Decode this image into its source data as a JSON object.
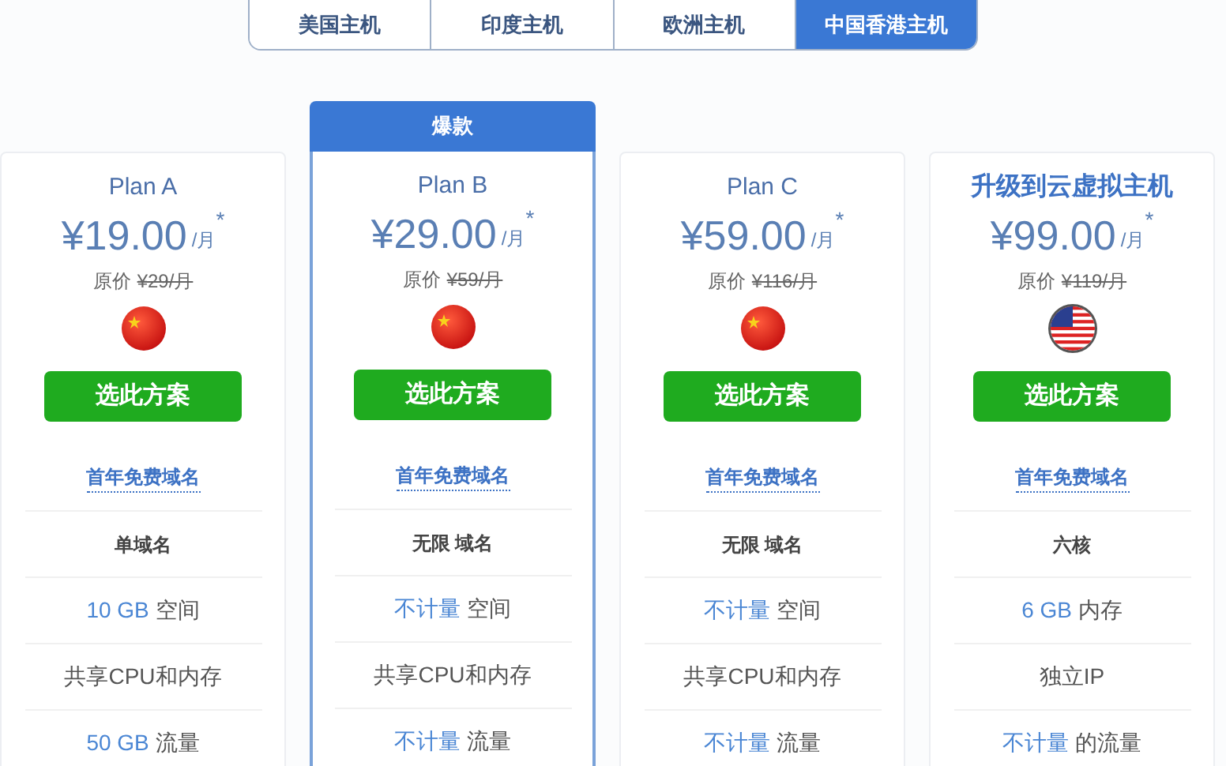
{
  "tabs": [
    {
      "label": "美国主机",
      "selected": false
    },
    {
      "label": "印度主机",
      "selected": false
    },
    {
      "label": "欧洲主机",
      "selected": false
    },
    {
      "label": "中国香港主机",
      "selected": true
    }
  ],
  "plans": [
    {
      "title": {
        "kind": "plain",
        "text": "Plan A"
      },
      "price": "¥19.00",
      "unit": "/月",
      "star": "*",
      "original_label": "原价",
      "original_price": "¥29/月",
      "flag": {
        "kind": "cn"
      },
      "button": "选此方案",
      "features": [
        {
          "kind": "link",
          "text": "首年免费域名"
        },
        {
          "kind": "bold",
          "text": "单域名"
        },
        {
          "kind": "plain",
          "highlight": "10 GB",
          "text": "空间"
        },
        {
          "kind": "plain",
          "text": "共享CPU和内存"
        },
        {
          "kind": "plain",
          "highlight": "50 GB",
          "text": "流量"
        }
      ]
    },
    {
      "title": {
        "kind": "plain",
        "text": "Plan B"
      },
      "badge": "爆款",
      "price": "¥29.00",
      "unit": "/月",
      "star": "*",
      "original_label": "原价",
      "original_price": "¥59/月",
      "flag": {
        "kind": "cn"
      },
      "button": "选此方案",
      "features": [
        {
          "kind": "link",
          "text": "首年免费域名"
        },
        {
          "kind": "bold",
          "text": "无限 域名"
        },
        {
          "kind": "plain",
          "highlight": "不计量",
          "text": "空间"
        },
        {
          "kind": "plain",
          "text": "共享CPU和内存"
        },
        {
          "kind": "plain",
          "highlight": "不计量",
          "text": "流量"
        }
      ]
    },
    {
      "title": {
        "kind": "plain",
        "text": "Plan C"
      },
      "price": "¥59.00",
      "unit": "/月",
      "star": "*",
      "original_label": "原价",
      "original_price": "¥116/月",
      "flag": {
        "kind": "cn"
      },
      "button": "选此方案",
      "features": [
        {
          "kind": "link",
          "text": "首年免费域名"
        },
        {
          "kind": "bold",
          "text": "无限 域名"
        },
        {
          "kind": "plain",
          "highlight": "不计量",
          "text": "空间"
        },
        {
          "kind": "plain",
          "text": "共享CPU和内存"
        },
        {
          "kind": "plain",
          "highlight": "不计量",
          "text": "流量"
        }
      ]
    },
    {
      "title": {
        "kind": "bold",
        "text": "升级到云虚拟主机"
      },
      "price": "¥99.00",
      "unit": "/月",
      "star": "*",
      "original_label": "原价",
      "original_price": "¥119/月",
      "flag": {
        "kind": "us"
      },
      "button": "选此方案",
      "features": [
        {
          "kind": "link",
          "text": "首年免费域名"
        },
        {
          "kind": "bold",
          "text": "六核"
        },
        {
          "kind": "plain",
          "highlight": "6 GB",
          "text": "内存"
        },
        {
          "kind": "plain",
          "text": "独立IP"
        },
        {
          "kind": "plain",
          "highlight": "不计量",
          "text": "的流量"
        }
      ]
    }
  ]
}
